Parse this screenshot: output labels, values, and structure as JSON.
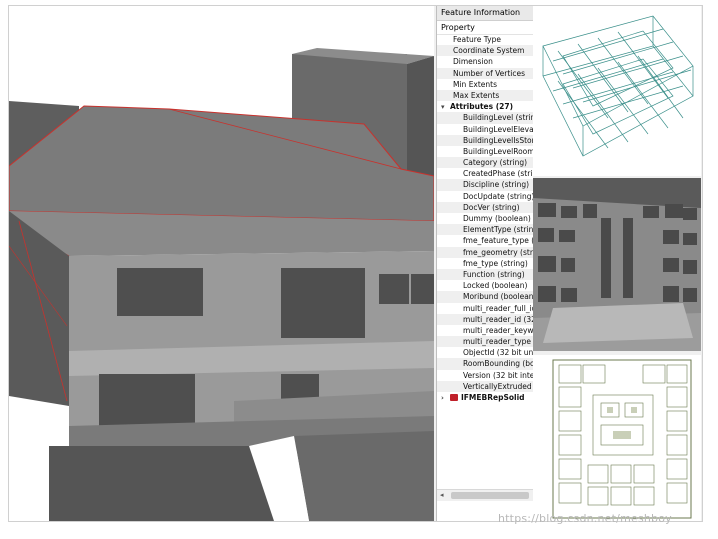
{
  "panel": {
    "title": "Feature Information",
    "column_header": "Property",
    "properties": [
      "Feature Type",
      "Coordinate System",
      "Dimension",
      "Number of Vertices",
      "Min Extents",
      "Max Extents"
    ],
    "attributes_group": "Attributes (27)",
    "attributes": [
      "BuildingLevel (string",
      "BuildingLevelElevat",
      "BuildingLevelIsStor",
      "BuildingLevelRoom",
      "Category (string)",
      "CreatedPhase (strin",
      "Discipline (string)",
      "DocUpdate (string)",
      "DocVer (string)",
      "Dummy (boolean)",
      "ElementType (string",
      "fme_feature_type (s",
      "fme_geometry (strin",
      "fme_type (string)",
      "Function (string)",
      "Locked (boolean)",
      "Moribund (boolean)",
      "multi_reader_full_id",
      "multi_reader_id (32",
      "multi_reader_keyw",
      "multi_reader_type (",
      "ObjectId (32 bit uns",
      "RoomBounding (bo",
      "Version (32 bit integ",
      "VerticallyExtruded ("
    ],
    "geometry_item": "IFMEBRepSolid"
  },
  "icons": {
    "collapse": "caret-down-icon",
    "expand": "caret-right-icon",
    "solid": "brep-solid-icon",
    "scroll_left": "scroll-left-arrow-icon"
  },
  "colors": {
    "building_edge": "#c8322d",
    "wireframe": "#3a8f8a",
    "model_gray": "#7a7a7a"
  },
  "watermark": "https://blog.csdn.net/meshboy"
}
